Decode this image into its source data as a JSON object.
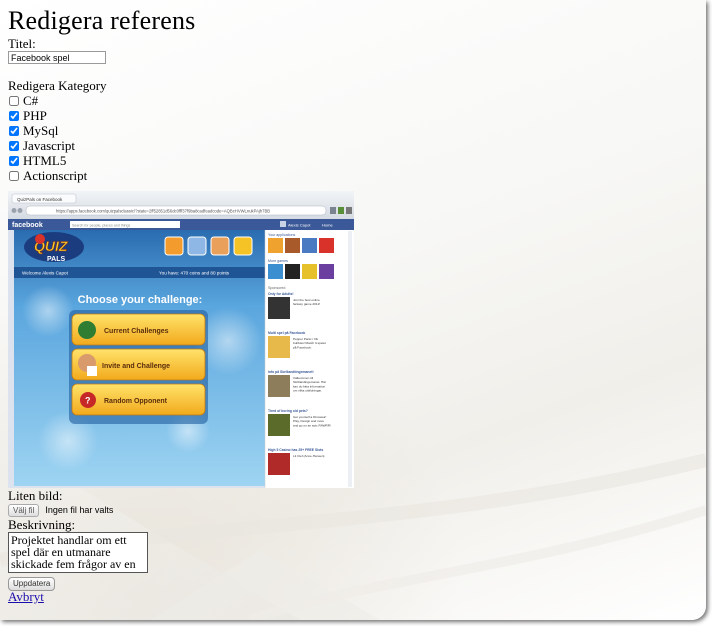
{
  "page": {
    "title": "Redigera referens",
    "title_label": "Titel:",
    "title_value": "Facebook spel",
    "category_heading": "Redigera Kategory",
    "categories": [
      {
        "label": "C#",
        "checked": false
      },
      {
        "label": "PHP",
        "checked": true
      },
      {
        "label": "MySql",
        "checked": true
      },
      {
        "label": "Javascript",
        "checked": true
      },
      {
        "label": "HTML5",
        "checked": true
      },
      {
        "label": "Actionscript",
        "checked": false
      }
    ],
    "small_image_label": "Liten bild:",
    "file_button": "Välj fil",
    "file_status": "Ingen fil har valts",
    "description_label": "Beskrivning:",
    "description_value": "Projektet handlar om ett spel där en utmanare skickade fem frågor av en viss",
    "update_button": "Uppdatera",
    "cancel_link": "Avbryt"
  },
  "screenshot": {
    "tab": "QuizPals on Facebook",
    "url": "https://apps.facebook.com/quizpalsclassic/?state=2ff52851d56dc0fff37f9ba8cadfeadcode=AQBcHVWLnukPAjh7BB",
    "fb_logo": "facebook",
    "search_placeholder": "Search for people, places and things",
    "user_name": "Alexis Capot",
    "home": "Home",
    "game_logo_top": "QUIZ",
    "game_logo_bottom": "PALS",
    "welcome": "Welcome Alexis Capot",
    "coins": "You have: 470 coins and 80 points",
    "heading": "Choose your challenge:",
    "buttons": [
      "Current Challenges",
      "Invite and Challenge",
      "Random Opponent"
    ],
    "sidebar": {
      "apps_title": "Your applications",
      "more_games": "More games",
      "sponsored": "Sponsored",
      "ads": [
        {
          "title": "Only for Adults!",
          "text": "Join the best online fantasy game 2012!"
        },
        {
          "title": "Multi spel på Facebook",
          "text": "Pepper Panic / Ok bubbles! Match 3-spelet på Facebook."
        },
        {
          "title": "Info på Skrillandtingemanet!",
          "text": "Välkommen till Skrillandingemanet. Här kan du hitta information om vilka utbildningar."
        },
        {
          "title": "Tired of boring old pets?",
          "text": "Get yourself a Dinosaur! Play, Design and more and go on an epic RAWRR!"
        },
        {
          "title": "High 5 Casino has 25+ FREE Slots",
          "text": "Lit Clef (Anne-Hansen)"
        }
      ]
    }
  }
}
